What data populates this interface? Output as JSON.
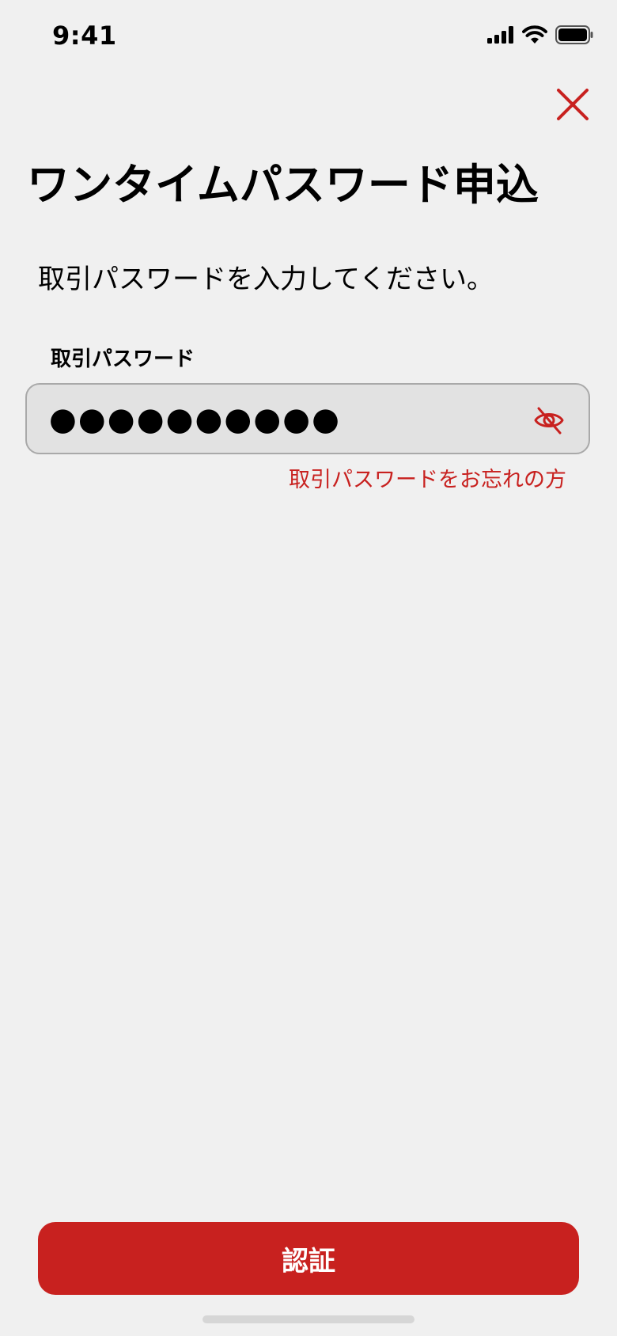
{
  "status_bar": {
    "time": "9:41",
    "signal_icon": "cellular-signal-icon",
    "wifi_icon": "wifi-icon",
    "battery_icon": "battery-icon"
  },
  "header": {
    "close_icon": "close-icon",
    "title": "ワンタイムパスワード申込"
  },
  "form": {
    "instruction": "取引パスワードを入力してください。",
    "password_label": "取引パスワード",
    "password_masked": "●●●●●●●●●●",
    "password_length": 10,
    "visibility_icon": "eye-slash-icon",
    "forgot_link": "取引パスワードをお忘れの方"
  },
  "footer": {
    "submit_label": "認証"
  },
  "colors": {
    "accent": "#c8211f",
    "background": "#f0f0f0",
    "input_background": "#e2e2e2",
    "input_border": "#a9a9a9"
  }
}
